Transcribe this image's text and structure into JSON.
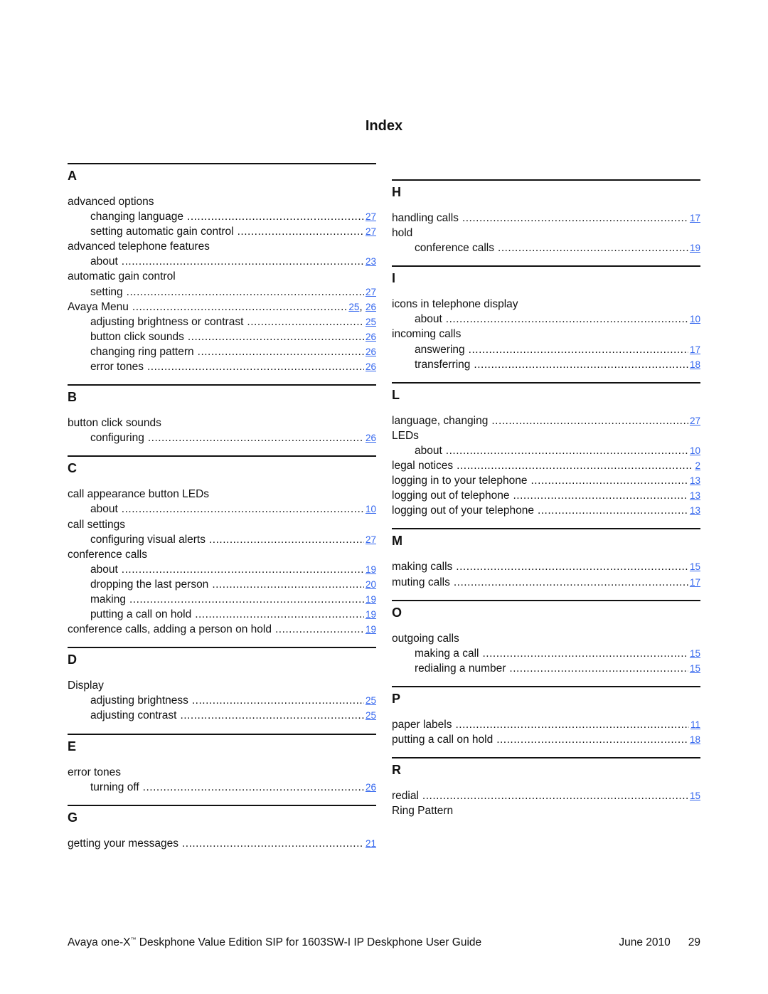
{
  "page_title": "Index",
  "colors": {
    "link": "#3366ee",
    "text": "#111111"
  },
  "left_column": [
    {
      "letter": "A",
      "entries": [
        {
          "term": "advanced options",
          "level": 0,
          "pages": []
        },
        {
          "term": "changing language",
          "level": 1,
          "pages": [
            "27"
          ]
        },
        {
          "term": "setting automatic gain control",
          "level": 1,
          "pages": [
            "27"
          ]
        },
        {
          "term": "advanced telephone features",
          "level": 0,
          "pages": []
        },
        {
          "term": "about",
          "level": 1,
          "pages": [
            "23"
          ]
        },
        {
          "term": "automatic gain control",
          "level": 0,
          "pages": []
        },
        {
          "term": "setting",
          "level": 1,
          "pages": [
            "27"
          ]
        },
        {
          "term": "Avaya Menu",
          "level": 0,
          "pages": [
            "25",
            "26"
          ]
        },
        {
          "term": "adjusting brightness or contrast",
          "level": 1,
          "pages": [
            "25"
          ]
        },
        {
          "term": "button click sounds",
          "level": 1,
          "pages": [
            "26"
          ]
        },
        {
          "term": "changing ring pattern",
          "level": 1,
          "pages": [
            "26"
          ]
        },
        {
          "term": "error tones",
          "level": 1,
          "pages": [
            "26"
          ]
        }
      ]
    },
    {
      "letter": "B",
      "entries": [
        {
          "term": "button click sounds",
          "level": 0,
          "pages": []
        },
        {
          "term": "configuring",
          "level": 1,
          "pages": [
            "26"
          ]
        }
      ]
    },
    {
      "letter": "C",
      "entries": [
        {
          "term": "call appearance button LEDs",
          "level": 0,
          "pages": []
        },
        {
          "term": "about",
          "level": 1,
          "pages": [
            "10"
          ]
        },
        {
          "term": "call settings",
          "level": 0,
          "pages": []
        },
        {
          "term": "configuring visual alerts",
          "level": 1,
          "pages": [
            "27"
          ]
        },
        {
          "term": "conference calls",
          "level": 0,
          "pages": []
        },
        {
          "term": "about",
          "level": 1,
          "pages": [
            "19"
          ]
        },
        {
          "term": "dropping the last person",
          "level": 1,
          "pages": [
            "20"
          ]
        },
        {
          "term": "making",
          "level": 1,
          "pages": [
            "19"
          ]
        },
        {
          "term": "putting a call on hold",
          "level": 1,
          "pages": [
            "19"
          ]
        },
        {
          "term": "conference calls, adding a person on hold",
          "level": 0,
          "pages": [
            "19"
          ]
        }
      ]
    },
    {
      "letter": "D",
      "entries": [
        {
          "term": "Display",
          "level": 0,
          "pages": []
        },
        {
          "term": "adjusting brightness",
          "level": 1,
          "pages": [
            "25"
          ]
        },
        {
          "term": "adjusting contrast",
          "level": 1,
          "pages": [
            "25"
          ]
        }
      ]
    },
    {
      "letter": "E",
      "entries": [
        {
          "term": "error tones",
          "level": 0,
          "pages": []
        },
        {
          "term": "turning off",
          "level": 1,
          "pages": [
            "26"
          ]
        }
      ]
    },
    {
      "letter": "G",
      "entries": [
        {
          "term": "getting your messages",
          "level": 0,
          "pages": [
            "21"
          ]
        }
      ]
    }
  ],
  "right_column": [
    {
      "letter": "H",
      "entries": [
        {
          "term": "handling calls",
          "level": 0,
          "pages": [
            "17"
          ]
        },
        {
          "term": "hold",
          "level": 0,
          "pages": []
        },
        {
          "term": "conference calls",
          "level": 1,
          "pages": [
            "19"
          ]
        }
      ]
    },
    {
      "letter": "I",
      "entries": [
        {
          "term": "icons in telephone display",
          "level": 0,
          "pages": []
        },
        {
          "term": "about",
          "level": 1,
          "pages": [
            "10"
          ]
        },
        {
          "term": "incoming calls",
          "level": 0,
          "pages": []
        },
        {
          "term": "answering",
          "level": 1,
          "pages": [
            "17"
          ]
        },
        {
          "term": "transferring",
          "level": 1,
          "pages": [
            "18"
          ]
        }
      ]
    },
    {
      "letter": "L",
      "entries": [
        {
          "term": "language, changing",
          "level": 0,
          "pages": [
            "27"
          ]
        },
        {
          "term": "LEDs",
          "level": 0,
          "pages": []
        },
        {
          "term": "about",
          "level": 1,
          "pages": [
            "10"
          ]
        },
        {
          "term": "legal notices",
          "level": 0,
          "pages": [
            "2"
          ]
        },
        {
          "term": "logging in to your telephone",
          "level": 0,
          "pages": [
            "13"
          ]
        },
        {
          "term": "logging out of telephone",
          "level": 0,
          "pages": [
            "13"
          ]
        },
        {
          "term": "logging out of your telephone",
          "level": 0,
          "pages": [
            "13"
          ]
        }
      ]
    },
    {
      "letter": "M",
      "entries": [
        {
          "term": "making calls",
          "level": 0,
          "pages": [
            "15"
          ]
        },
        {
          "term": "muting calls",
          "level": 0,
          "pages": [
            "17"
          ]
        }
      ]
    },
    {
      "letter": "O",
      "entries": [
        {
          "term": "outgoing calls",
          "level": 0,
          "pages": []
        },
        {
          "term": "making a call",
          "level": 1,
          "pages": [
            "15"
          ]
        },
        {
          "term": "redialing a number",
          "level": 1,
          "pages": [
            "15"
          ]
        }
      ]
    },
    {
      "letter": "P",
      "entries": [
        {
          "term": "paper labels",
          "level": 0,
          "pages": [
            "11"
          ]
        },
        {
          "term": "putting a call on hold",
          "level": 0,
          "pages": [
            "18"
          ]
        }
      ]
    },
    {
      "letter": "R",
      "entries": [
        {
          "term": "redial",
          "level": 0,
          "pages": [
            "15"
          ]
        },
        {
          "term": "Ring Pattern",
          "level": 0,
          "pages": []
        }
      ]
    }
  ],
  "footer": {
    "guide_prefix": "Avaya one-X",
    "trademark": "™",
    "guide_suffix": " Deskphone Value Edition SIP for 1603SW-I IP Deskphone User Guide",
    "date": "June 2010",
    "page_number": "29"
  }
}
